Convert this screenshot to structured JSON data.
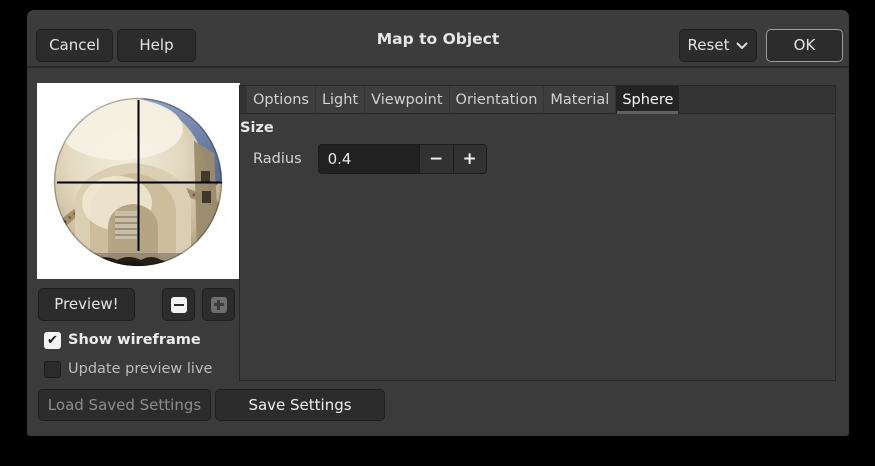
{
  "window": {
    "title": "Map to Object"
  },
  "header": {
    "cancel_label": "Cancel",
    "help_label": "Help",
    "reset_label": "Reset",
    "ok_label": "OK"
  },
  "tabs": [
    {
      "label": "Options",
      "active": false
    },
    {
      "label": "Light",
      "active": false
    },
    {
      "label": "Viewpoint",
      "active": false
    },
    {
      "label": "Orientation",
      "active": false
    },
    {
      "label": "Material",
      "active": false
    },
    {
      "label": "Sphere",
      "active": true
    }
  ],
  "sphere_tab": {
    "section_title": "Size",
    "radius_label": "Radius",
    "radius_value": "0.4"
  },
  "left_panel": {
    "preview_button_label": "Preview!",
    "show_wireframe_label": "Show wireframe",
    "show_wireframe_checked": true,
    "update_preview_label": "Update preview live",
    "update_preview_checked": false
  },
  "footer": {
    "load_settings_label": "Load Saved Settings",
    "load_settings_enabled": false,
    "save_settings_label": "Save Settings"
  },
  "icons": {
    "checkmark": "✔",
    "minus": "−",
    "plus": "+"
  },
  "colors": {
    "window_bg": "#3b3b3b",
    "button_bg": "#2c2c2c",
    "input_bg": "#212121",
    "ok_border": "#9d9d9d",
    "active_tab_bg": "#232323",
    "preview_bg": "#ffffff"
  }
}
